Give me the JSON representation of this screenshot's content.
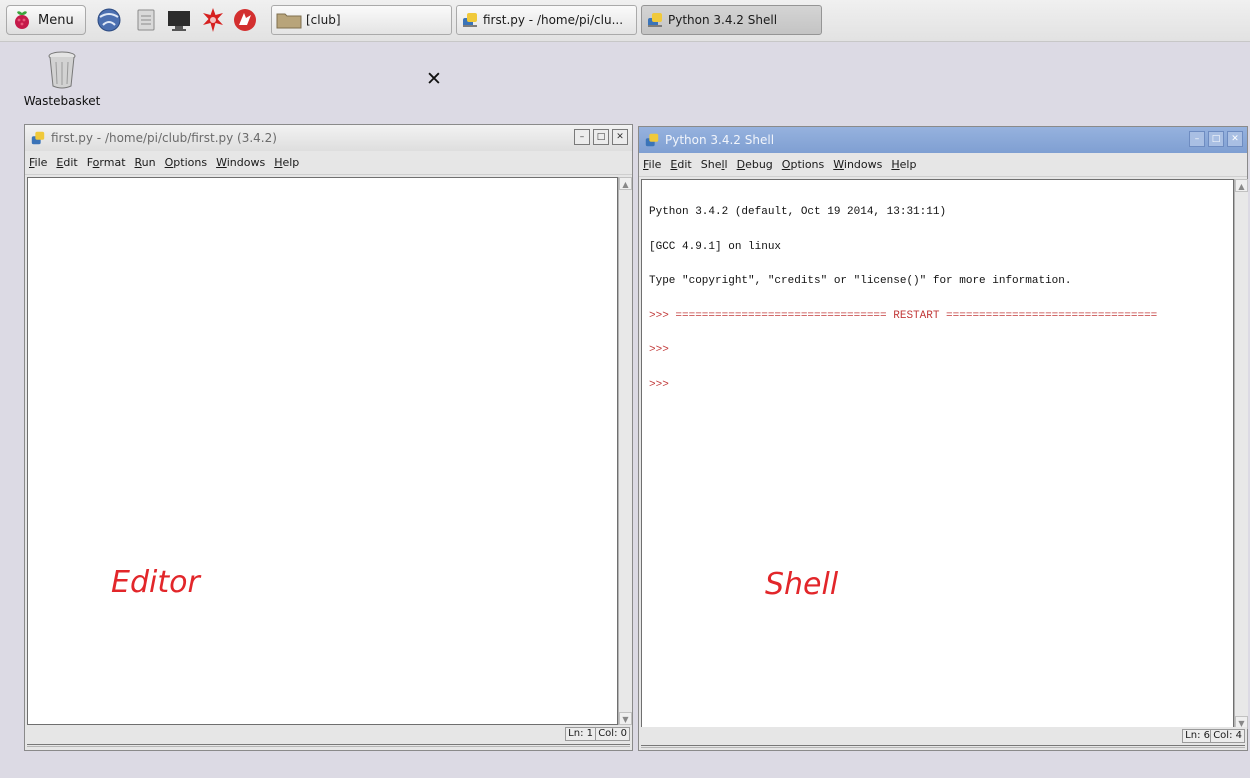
{
  "taskbar": {
    "menu_label": "Menu",
    "launcher_icons": [
      "web-browser-icon",
      "file-manager-icon",
      "terminal-icon",
      "wolfram-icon",
      "mathematica-icon"
    ],
    "tasks": [
      {
        "label": "[club]",
        "icon": "folder-icon"
      },
      {
        "label": "first.py - /home/pi/clu...",
        "icon": "python-icon"
      },
      {
        "label": "Python 3.4.2 Shell",
        "icon": "python-icon",
        "active": true
      }
    ]
  },
  "desktop": {
    "wastebasket_label": "Wastebasket",
    "close_symbol": "✕"
  },
  "editor_window": {
    "title": "first.py - /home/pi/club/first.py (3.4.2)",
    "menus": [
      "File",
      "Edit",
      "Format",
      "Run",
      "Options",
      "Windows",
      "Help"
    ],
    "menu_mnemonics": [
      "F",
      "E",
      "o",
      "R",
      "O",
      "W",
      "H"
    ],
    "status_ln": "Ln: 1",
    "status_col": "Col: 0",
    "annotation": "Editor"
  },
  "shell_window": {
    "title": "Python 3.4.2 Shell",
    "menus": [
      "File",
      "Edit",
      "Shell",
      "Debug",
      "Options",
      "Windows",
      "Help"
    ],
    "menu_mnemonics": [
      "F",
      "E",
      "l",
      "D",
      "O",
      "W",
      "H"
    ],
    "lines": [
      {
        "text": "Python 3.4.2 (default, Oct 19 2014, 13:31:11)",
        "prompt": false
      },
      {
        "text": "[GCC 4.9.1] on linux",
        "prompt": false
      },
      {
        "text": "Type \"copyright\", \"credits\" or \"license()\" for more information.",
        "prompt": false
      },
      {
        "text": ">>> ================================ RESTART ================================",
        "prompt": true
      },
      {
        "text": ">>>",
        "prompt": true
      },
      {
        "text": ">>>",
        "prompt": true
      }
    ],
    "status_ln": "Ln: 6",
    "status_col": "Col: 4",
    "annotation": "Shell"
  },
  "colors": {
    "desktop": "#dcdae4",
    "active_titlebar": "#8aa8d8",
    "prompt": "#c23a3a",
    "annotation": "#e2262a"
  }
}
